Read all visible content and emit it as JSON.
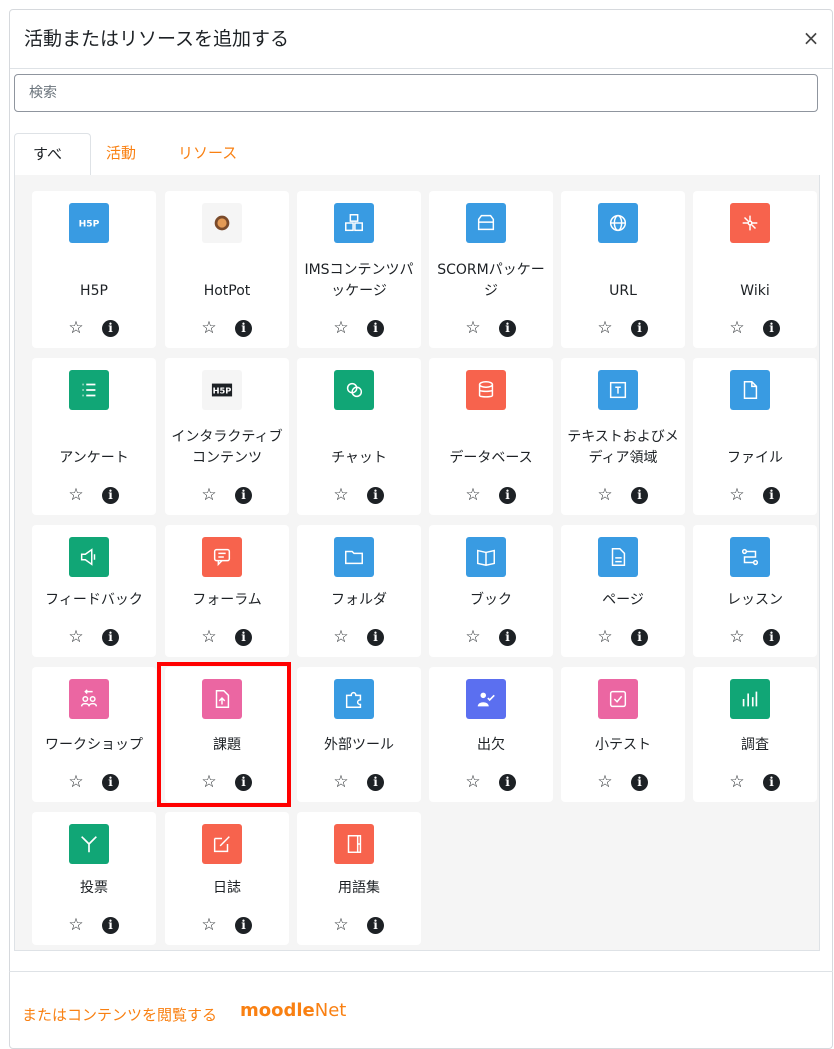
{
  "modal": {
    "title": "活動またはリソースを追加する",
    "close": "×"
  },
  "search": {
    "placeholder": "検索"
  },
  "tabs": [
    {
      "label": "すべて",
      "active": true
    },
    {
      "label": "活動",
      "active": false
    },
    {
      "label": "リソース",
      "active": false
    }
  ],
  "items": [
    {
      "name": "H5P",
      "icon": "h5p-icon",
      "color": "#399be2"
    },
    {
      "name": "HotPot",
      "icon": "hotpot-icon",
      "color": "#f5f5f5"
    },
    {
      "name": "IMSコンテンツパッケージ",
      "icon": "package-icon",
      "color": "#399be2"
    },
    {
      "name": "SCORMパッケージ",
      "icon": "box-icon",
      "color": "#399be2"
    },
    {
      "name": "URL",
      "icon": "globe-icon",
      "color": "#399be2"
    },
    {
      "name": "Wiki",
      "icon": "wiki-icon",
      "color": "#f7634d"
    },
    {
      "name": "アンケート",
      "icon": "list-icon",
      "color": "#11a676"
    },
    {
      "name": "インタラクティブコンテンツ",
      "icon": "h5p-dark-icon",
      "color": "#f5f5f5"
    },
    {
      "name": "チャット",
      "icon": "chat-icon",
      "color": "#11a676"
    },
    {
      "name": "データベース",
      "icon": "database-icon",
      "color": "#f7634d"
    },
    {
      "name": "テキストおよびメディア領域",
      "icon": "text-frame-icon",
      "color": "#399be2"
    },
    {
      "name": "ファイル",
      "icon": "file-icon",
      "color": "#399be2"
    },
    {
      "name": "フィードバック",
      "icon": "megaphone-icon",
      "color": "#11a676"
    },
    {
      "name": "フォーラム",
      "icon": "forum-icon",
      "color": "#f7634d"
    },
    {
      "name": "フォルダ",
      "icon": "folder-icon",
      "color": "#399be2"
    },
    {
      "name": "ブック",
      "icon": "book-icon",
      "color": "#399be2"
    },
    {
      "name": "ページ",
      "icon": "page-icon",
      "color": "#399be2"
    },
    {
      "name": "レッスン",
      "icon": "lesson-icon",
      "color": "#399be2"
    },
    {
      "name": "ワークショップ",
      "icon": "workshop-icon",
      "color": "#eb66a2"
    },
    {
      "name": "課題",
      "icon": "assignment-icon",
      "color": "#eb66a2"
    },
    {
      "name": "外部ツール",
      "icon": "puzzle-icon",
      "color": "#399be2"
    },
    {
      "name": "出欠",
      "icon": "attendance-icon",
      "color": "#5b6ff0"
    },
    {
      "name": "小テスト",
      "icon": "quiz-icon",
      "color": "#eb66a2"
    },
    {
      "name": "調査",
      "icon": "survey-icon",
      "color": "#11a676"
    },
    {
      "name": "投票",
      "icon": "choice-icon",
      "color": "#11a676"
    },
    {
      "name": "日誌",
      "icon": "journal-icon",
      "color": "#f7634d"
    },
    {
      "name": "用語集",
      "icon": "glossary-icon",
      "color": "#f7634d"
    }
  ],
  "actions": {
    "star": "☆",
    "info": "i"
  },
  "footer": {
    "link": "またはコンテンツを閲覧する",
    "brand_a": "moodle",
    "brand_b": "Net"
  }
}
